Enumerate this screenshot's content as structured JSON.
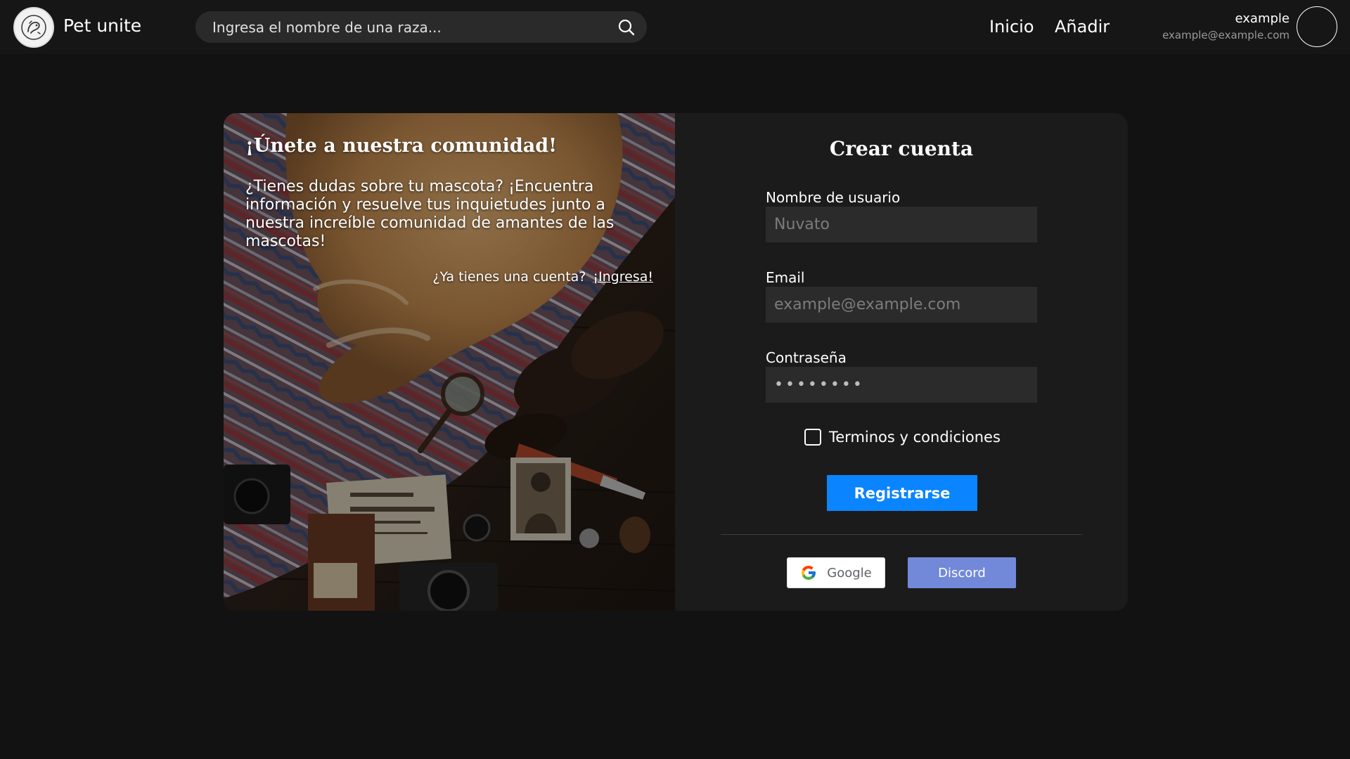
{
  "header": {
    "brand": "Pet unite",
    "search_placeholder": "Ingresa el nombre de una raza...",
    "nav": {
      "home": "Inicio",
      "add": "Añadir"
    },
    "user": {
      "name": "example",
      "email": "example@example.com"
    }
  },
  "panel": {
    "title": "¡Únete a nuestra comunidad!",
    "text": "¿Tienes dudas sobre tu mascota? ¡Encuentra información y resuelve tus inquietudes junto a nuestra increíble comunidad de amantes de las mascotas!",
    "login_prompt": "¿Ya tienes una cuenta?",
    "login_link": "¡Ingresa!"
  },
  "form": {
    "title": "Crear cuenta",
    "username_label": "Nombre de usuario",
    "username_placeholder": "Nuvato",
    "email_label": "Email",
    "email_placeholder": "example@example.com",
    "password_label": "Contraseña",
    "password_placeholder": "••••••••",
    "terms_label": "Terminos y condiciones",
    "terms_checked": false,
    "submit_label": "Registrarse",
    "google_label": "Google",
    "discord_label": "Discord"
  },
  "colors": {
    "background": "#121212",
    "header": "#161616",
    "card": "#1b1b1b",
    "input": "#2b2b2b",
    "primary": "#0a84ff",
    "discord": "#7289da"
  }
}
